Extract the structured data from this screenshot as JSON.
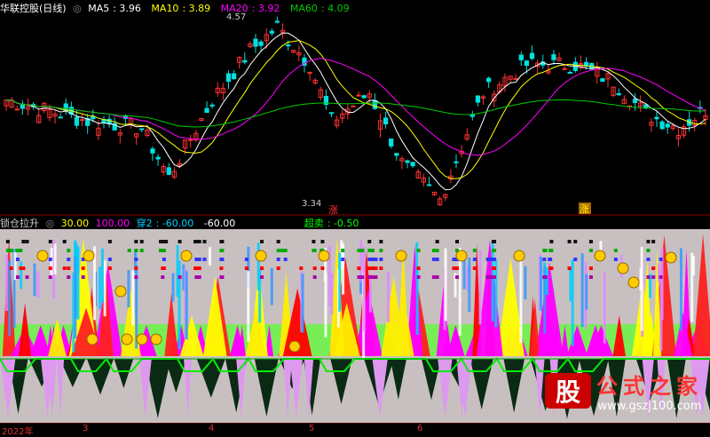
{
  "chart_data": [
    {
      "type": "line",
      "title": "华联控股(日线)",
      "legend": [
        {
          "name": "MA5",
          "value": "3.96",
          "color": "#ffffff"
        },
        {
          "name": "MA10",
          "value": "3.89",
          "color": "#ffff00"
        },
        {
          "name": "MA20",
          "value": "3.92",
          "color": "#ff00ff"
        },
        {
          "name": "MA60",
          "value": "4.09",
          "color": "#00cc00"
        }
      ],
      "annotations": [
        "4.57",
        "3.34",
        "涨",
        "涨"
      ],
      "high": 4.57,
      "low": 3.34
    },
    {
      "type": "area",
      "title": "锁仓拉升",
      "legend": [
        {
          "name": "",
          "value": "30.00",
          "color": "#ffff00"
        },
        {
          "name": "",
          "value": "100.00",
          "color": "#ff00ff"
        },
        {
          "name": "穿2",
          "value": "-60.00",
          "color": "#00ccff"
        },
        {
          "name": "",
          "value": "-60.00",
          "color": "#ffffff"
        },
        {
          "name": "超卖",
          "value": "-0.50",
          "color": "#00ff00"
        }
      ]
    }
  ],
  "x_axis": [
    "2022年",
    "3",
    "4",
    "5",
    "6"
  ],
  "brand": {
    "logo": "股",
    "name": "公式之家",
    "url": "www.gszj100.com"
  }
}
